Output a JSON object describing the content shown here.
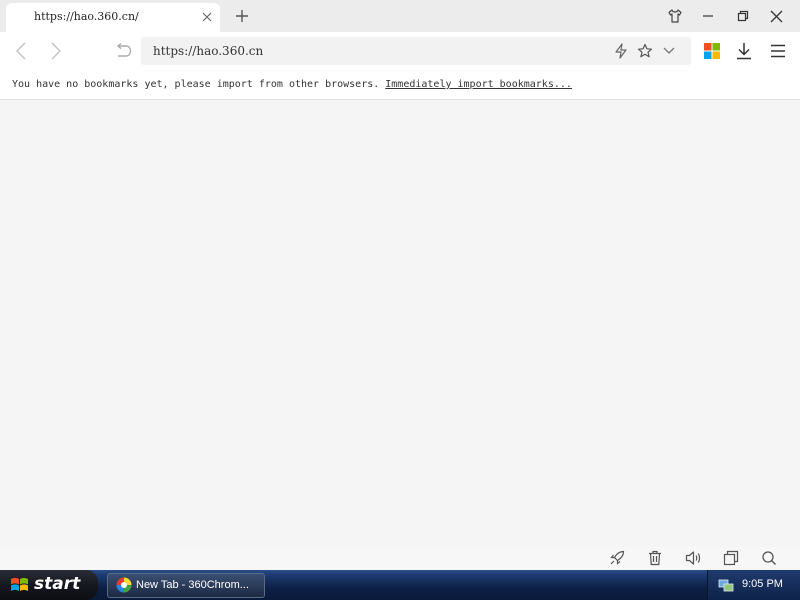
{
  "tab": {
    "title": "https://hao.360.cn/"
  },
  "address": {
    "url": "https://hao.360.cn"
  },
  "bookmark_bar": {
    "message": "You have no bookmarks yet, please import from other browsers.",
    "link": "Immediately import bookmarks..."
  },
  "taskbar": {
    "start_label": "start",
    "task_label": "New Tab - 360Chrom...",
    "clock": "9:05 PM"
  },
  "colors": {
    "content_bg": "#f5f5f5",
    "taskbar": "#0d1f45",
    "ms_red": "#f25022",
    "ms_green": "#7fba00",
    "ms_blue": "#00a4ef",
    "ms_yellow": "#ffb900"
  }
}
